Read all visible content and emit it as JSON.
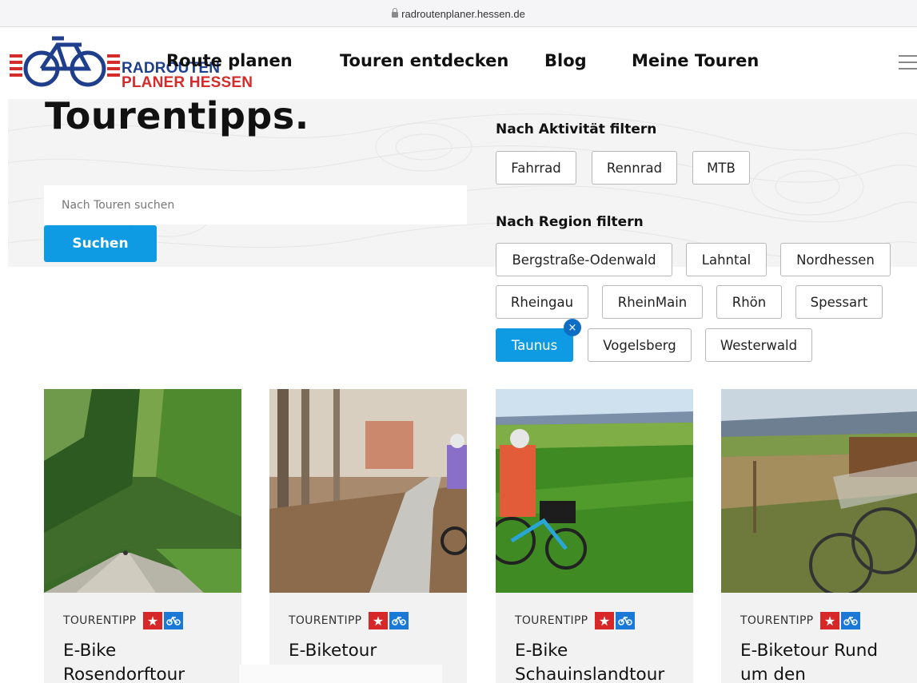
{
  "browser": {
    "url": "radroutenplaner.hessen.de"
  },
  "logo": {
    "line1": "RADROUTEN",
    "line2": "PLANER HESSEN"
  },
  "nav": {
    "items": [
      "Route planen",
      "Touren entdecken",
      "Blog",
      "Meine Touren"
    ]
  },
  "hero": {
    "title": "Tourentipps.",
    "search_placeholder": "Nach Touren suchen",
    "search_button": "Suchen"
  },
  "filters": {
    "activity_heading": "Nach Aktivität filtern",
    "activities": [
      "Fahrrad",
      "Rennrad",
      "MTB"
    ],
    "region_heading": "Nach Region filtern",
    "regions": [
      "Bergstraße-Odenwald",
      "Lahntal",
      "Nordhessen",
      "Rheingau",
      "RheinMain",
      "Rhön",
      "Spessart",
      "Taunus",
      "Vogelsberg",
      "Westerwald"
    ],
    "active_region": "Taunus",
    "remove_icon": "×"
  },
  "cards": [
    {
      "label": "TOURENTIPP",
      "title": "E-Bike Rosendorftour"
    },
    {
      "label": "TOURENTIPP",
      "title": "E-Biketour Usatal/Köpperner"
    },
    {
      "label": "TOURENTIPP",
      "title": "E-Bike Schauinslandtour"
    },
    {
      "label": "TOURENTIPP",
      "title": "E-Biketour Rund um den"
    }
  ],
  "colors": {
    "accent": "#0f9be3",
    "logo_blue": "#1f3e8c",
    "logo_red": "#d42b2b",
    "badge_red": "#d62828",
    "badge_blue": "#1a79d6"
  },
  "icons": {
    "badge1": "star-icon",
    "badge2": "bicycle-icon"
  }
}
